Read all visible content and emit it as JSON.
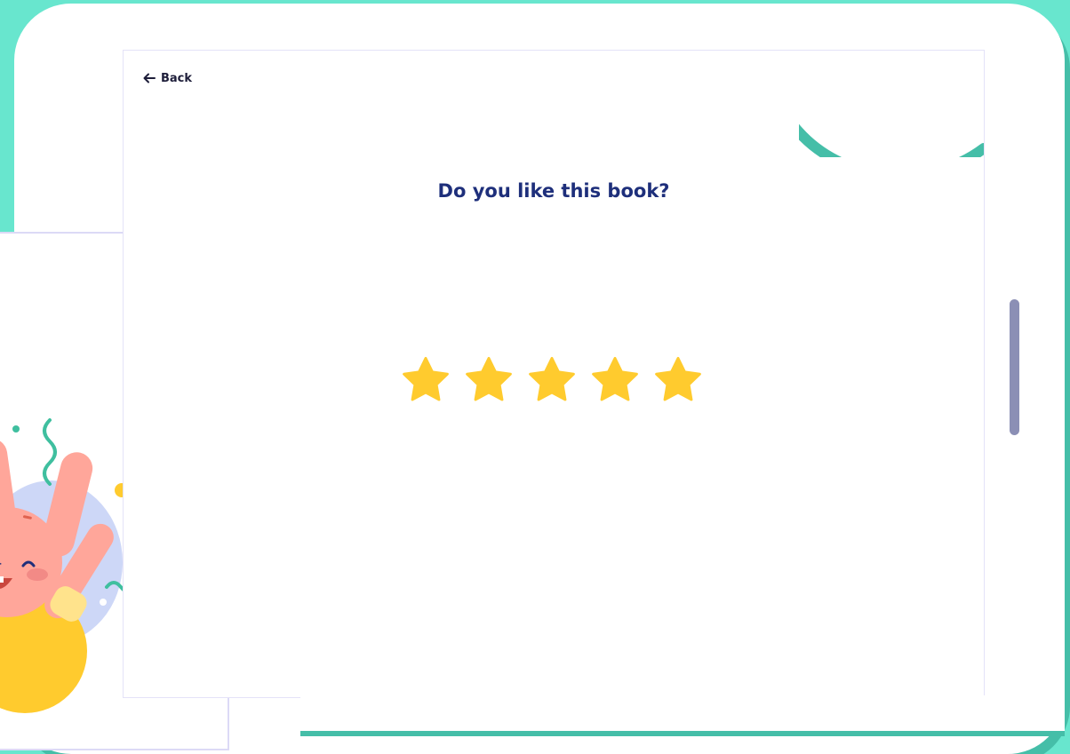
{
  "nav": {
    "back_label": "Back"
  },
  "question": "Do you like this book?",
  "rating": {
    "max": 5,
    "value": 5
  },
  "colors": {
    "background": "#68E6CE",
    "accent_teal": "#45BEA8",
    "star": "#FFCB2E",
    "question_text": "#1E2F7B",
    "scrollbar": "#8B8FB5"
  },
  "icons": [
    "arrow-left-icon",
    "star-icon",
    "bunny-illustration"
  ]
}
